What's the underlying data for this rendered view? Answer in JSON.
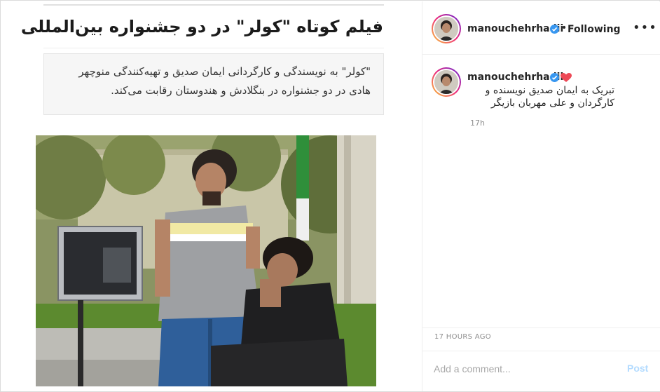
{
  "article": {
    "headline": "فیلم کوتاه \"کولر\" در دو جشنواره بین‌المللی",
    "lead_line1": "\"کولر\" به نویسندگی و کارگردانی ایمان صدیق و تهیه‌کنندگی منوچهر",
    "lead_line2": "هادی در دو جشنواره در بنگلادش و هندوستان رقابت می‌کند."
  },
  "header": {
    "username": "manouchehrhadii",
    "separator": "•",
    "follow_label": "Following",
    "more_label": "•••"
  },
  "comment": {
    "username": "manouchehrhadii",
    "text_line1": "تبریک به ایمان صدیق نویسنده و",
    "text_line2": "کارگردان و علی مهربان بازیگر",
    "time": "17h"
  },
  "footer": {
    "timestamp": "17 HOURS AGO",
    "comment_placeholder": "Add a comment...",
    "post_label": "Post"
  },
  "colors": {
    "verified": "#3897f0",
    "heart": "#ed4956",
    "post_disabled": "#b3dbff"
  },
  "icons": {
    "verified": "verified-badge-icon",
    "heart": "heart-emoji-icon",
    "more": "more-options-icon"
  }
}
